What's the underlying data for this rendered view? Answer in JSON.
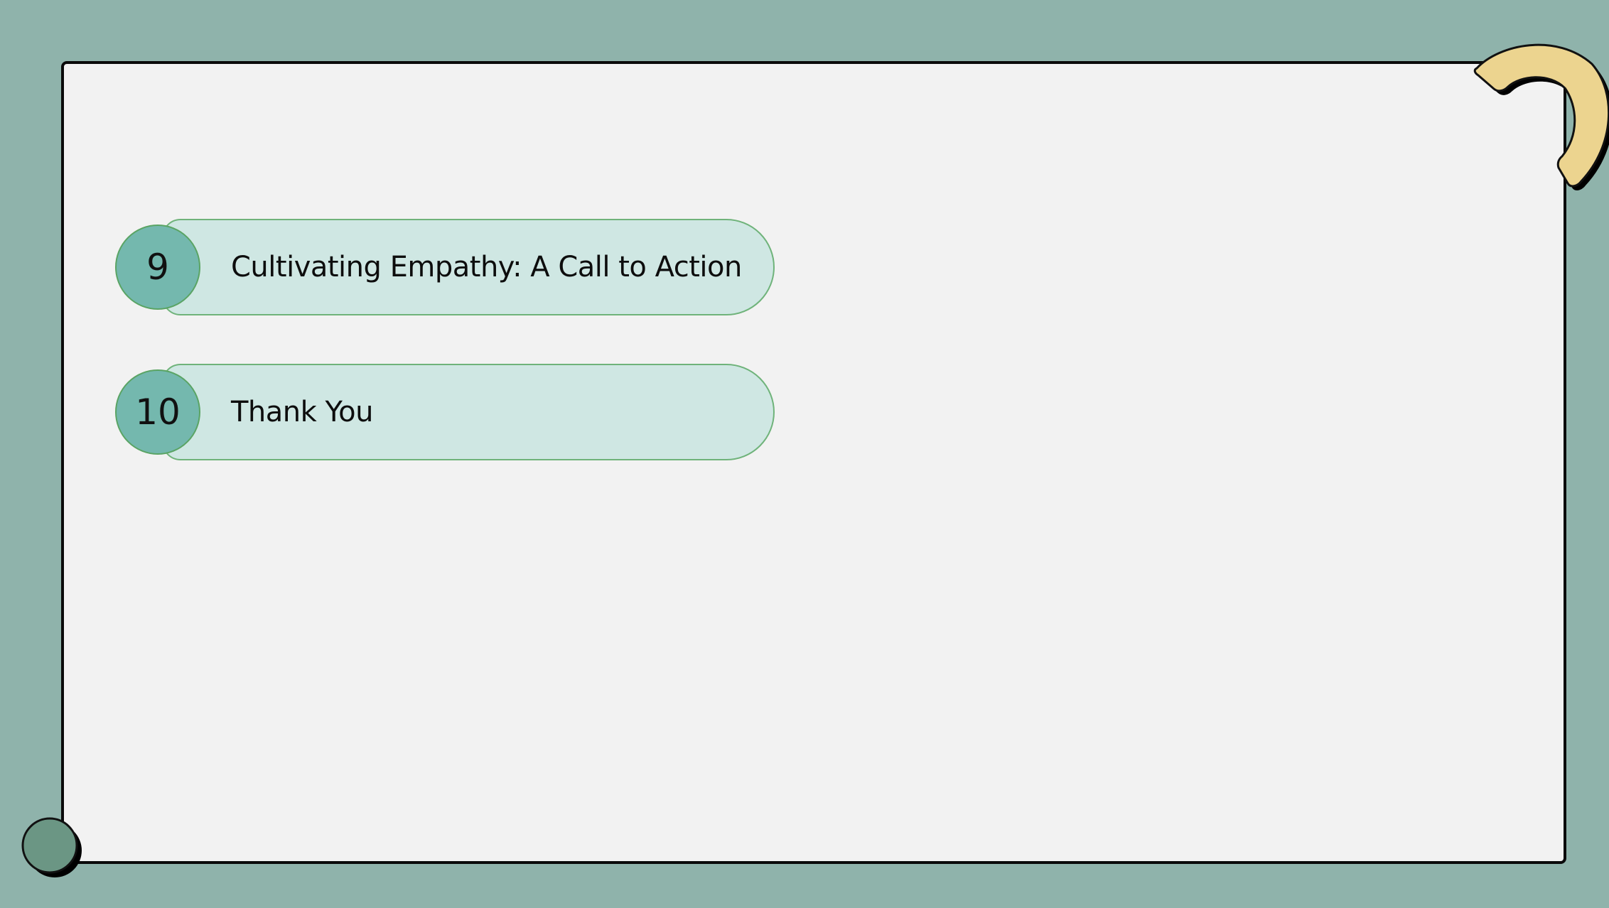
{
  "agenda": {
    "items": [
      {
        "number": "9",
        "title": "Cultivating Empathy: A Call to Action"
      },
      {
        "number": "10",
        "title": "Thank You"
      }
    ]
  },
  "colors": {
    "frame": "#8fb3ab",
    "panel": "#f2f2f2",
    "pill_fill": "#cfe7e3",
    "badge_fill": "#74b8ae",
    "accent_arc": "#ecd48f",
    "accent_dot": "#6b9684"
  },
  "icons": {
    "corner_decoration": "arc-decoration-icon",
    "bottom_decoration": "circle-decoration-icon"
  }
}
